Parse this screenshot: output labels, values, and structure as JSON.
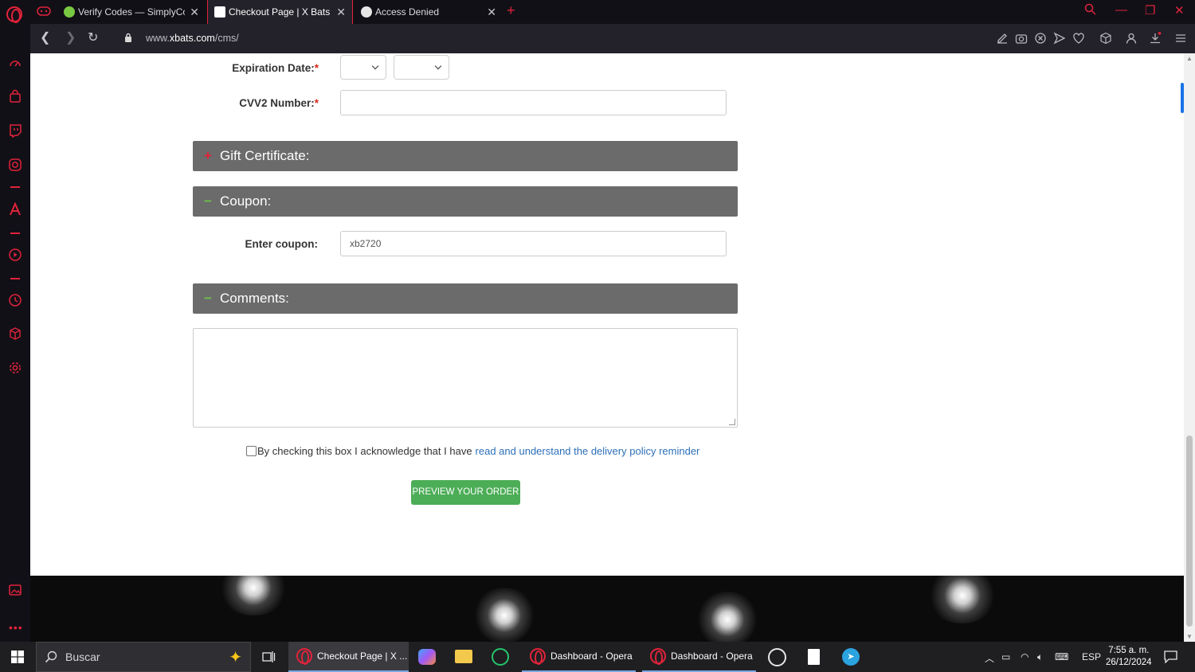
{
  "browser": {
    "tabs": [
      {
        "title": "Verify Codes — SimplyCodes",
        "favicon": "simplycodes-check-icon",
        "active": false
      },
      {
        "title": "Checkout Page | X Bats The Leader",
        "favicon": "xbats-logo-icon",
        "active": true
      },
      {
        "title": "Access Denied",
        "favicon": "globe-icon",
        "active": false
      }
    ],
    "url_prefix": "www.",
    "url_domain": "xbats.com",
    "url_path": "/cms/",
    "accent_color": "#e0233a"
  },
  "form": {
    "expiration_label": "Expiration Date:",
    "cvv_label": "CVV2 Number:",
    "required_mark": "*",
    "expiration_month_value": "",
    "expiration_year_value": "",
    "cvv_value": ""
  },
  "panels": {
    "gift": {
      "sign": "+",
      "title": "Gift Certificate:"
    },
    "coupon": {
      "sign": "−",
      "title": "Coupon:"
    },
    "comments": {
      "sign": "−",
      "title": "Comments:"
    }
  },
  "coupon": {
    "label": "Enter coupon:",
    "value": "xb2720"
  },
  "comments": {
    "value": ""
  },
  "acknowledge": {
    "text": "By checking this box I acknowledge that I have",
    "link_text": "read and understand the delivery policy reminder",
    "checked": false
  },
  "preview_button": {
    "label": "PREVIEW YOUR ORDER",
    "color": "#4cad57"
  },
  "taskbar": {
    "search_placeholder": "Buscar",
    "buttons": [
      {
        "label": "Checkout Page | X ..."
      },
      {
        "label": "Dashboard - Opera"
      },
      {
        "label": "Dashboard - Opera"
      }
    ],
    "language": "ESP",
    "time": "7:55 a. m.",
    "date": "26/12/2024"
  }
}
